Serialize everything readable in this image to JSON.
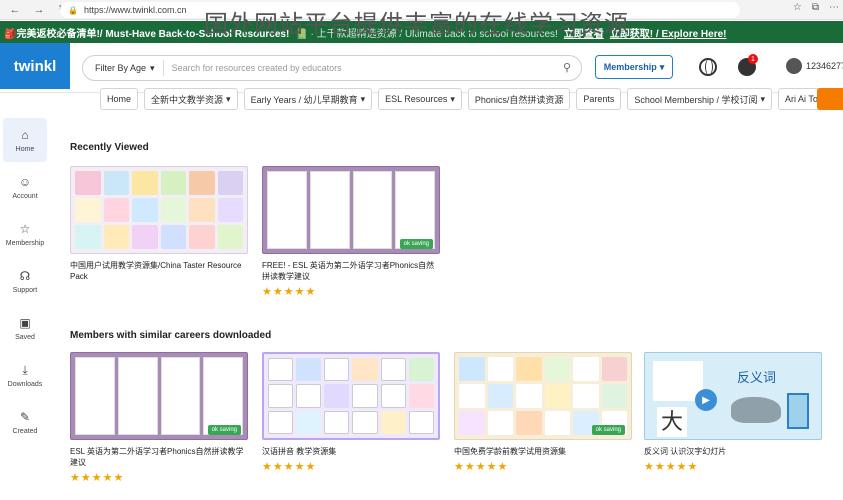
{
  "browser": {
    "url": "https://www.twinkl.com.cn",
    "back_icon": "back-arrow-icon",
    "reload_icon": "reload-icon"
  },
  "watermark_title": "国外网站平台提供丰富的在线学习资源",
  "promo": {
    "part1": "🎒完美返校必备清单!/ Must-Have Back-to-School Resources!",
    "part2": "📗 · 上千款超精选资源 / Ultimate back to school resources!",
    "cta1": "立即查看",
    "cta2": "立即获取! / Explore Here!"
  },
  "header": {
    "logo": "twinkl",
    "filter_label": "Filter By Age",
    "search_placeholder": "Search for resources created by educators",
    "membership_label": "Membership",
    "notif_count": "1",
    "user_id": "12346277"
  },
  "categories": [
    "Home",
    "全新中文教学资源",
    "Early Years / 幼儿早期教育",
    "ESL Resources",
    "Phonics/自然拼读资源",
    "Parents",
    "School Membership / 学校订阅",
    "Ari Ai Tool"
  ],
  "sidebar": [
    {
      "label": "Home",
      "icon": "home-icon",
      "glyph": "⌂"
    },
    {
      "label": "Account",
      "icon": "account-icon",
      "glyph": "☺"
    },
    {
      "label": "Membership",
      "icon": "star-outline-icon",
      "glyph": "☆"
    },
    {
      "label": "Support",
      "icon": "headset-icon",
      "glyph": "☊"
    },
    {
      "label": "Saved",
      "icon": "bookmark-icon",
      "glyph": "▣"
    },
    {
      "label": "Downloads",
      "icon": "download-icon",
      "glyph": "⤓"
    },
    {
      "label": "Created",
      "icon": "pencil-icon",
      "glyph": "✎"
    }
  ],
  "sections": {
    "recent": "Recently Viewed",
    "similar": "Members with similar careers downloaded"
  },
  "recent_cards": [
    {
      "title": "中国用户试用教学资源集/China Taster Resource Pack",
      "stars": "★★★★★"
    },
    {
      "title": "FREE! - ESL 英语为第二外语学习者Phonics自然拼读教学建议",
      "stars": "★★★★★",
      "tag": "ok saving"
    }
  ],
  "similar_cards": [
    {
      "title": "ESL 英语为第二外语学习者Phonics自然拼读教学建议",
      "stars": "★★★★★",
      "tag": "ok saving"
    },
    {
      "title": "汉语拼音 教学资源集",
      "stars": "★★★★★"
    },
    {
      "title": "中国免费学龄前教学试用资源集",
      "stars": "★★★★★",
      "tag": "ok saving"
    },
    {
      "title": "反义词 认识汉字幻灯片",
      "stars": "★★★★★",
      "slide_title": "反义词",
      "big_char": "大"
    }
  ]
}
